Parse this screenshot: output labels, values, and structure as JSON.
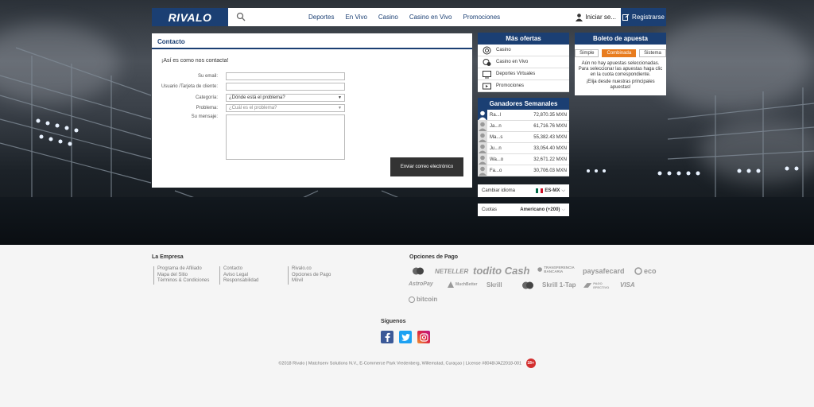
{
  "brand": {
    "logo_text": "RIVALO",
    "primary_color": "#1b3f73",
    "accent_color": "#e87c1e"
  },
  "header": {
    "nav": [
      "Deportes",
      "En Vivo",
      "Casino",
      "Casino en Vivo",
      "Promociones"
    ],
    "login_label": "Iniciar se...",
    "register_label": "Registrarse"
  },
  "contact": {
    "title": "Contacto",
    "intro": "¡Así es como nos contacta!",
    "fields": {
      "email_label": "Su email:",
      "user_label": "Usuario /Tarjeta de cliente:",
      "category_label": "Categoría:",
      "category_value": "¿Dónde está el problema?",
      "problem_label": "Problema:",
      "problem_value": "¿Cuál es el problema?",
      "message_label": "Su mensaje:"
    },
    "send_label": "Enviar correo electrónico"
  },
  "offers": {
    "title": "Más ofertas",
    "items": [
      {
        "label": "Casino",
        "icon": "casino-chip-icon"
      },
      {
        "label": "Casino en Vivo",
        "icon": "live-casino-icon"
      },
      {
        "label": "Deportes Virtuales",
        "icon": "virtual-sports-icon"
      },
      {
        "label": "Promociones",
        "icon": "promotions-icon"
      }
    ]
  },
  "winners": {
    "title": "Ganadores Semanales",
    "rows": [
      {
        "name": "Ra...l",
        "amount": "72,870.35 MXN"
      },
      {
        "name": "Ja...n",
        "amount": "61,716.76 MXN"
      },
      {
        "name": "Ma...s",
        "amount": "55,382.43 MXN"
      },
      {
        "name": "Ju...n",
        "amount": "33,054.40 MXN"
      },
      {
        "name": "Wa...o",
        "amount": "32,671.22 MXN"
      },
      {
        "name": "Fa...o",
        "amount": "30,706.03 MXN"
      }
    ]
  },
  "language": {
    "label": "Cambiar idioma",
    "value": "ES-MX"
  },
  "odds": {
    "label": "Cuotas",
    "value": "Americano (+200)"
  },
  "betslip": {
    "title": "Boleto de apuesta",
    "tabs": [
      "Simple",
      "Combinada",
      "Sistema"
    ],
    "message": "Aún no hay apuestas seleccionadas. Para seleccionar las apuestas haga clic en la cuota correspondiente.",
    "cta": "¡Elija desde nuestras principales apuestas!"
  },
  "footer": {
    "company_title": "La Empresa",
    "col1": [
      "Programa de Afiliado",
      "Mapa del Sitio",
      "Términos & Condiciones"
    ],
    "col2": [
      "Contacto",
      "Aviso Legal",
      "Responsabilidad"
    ],
    "col3": [
      "Rivalo.co",
      "Opciones de Pago",
      "Móvil"
    ],
    "payment_title": "Opciones de Pago",
    "payments": [
      "mastercard",
      "NETELLER",
      "todito Cash",
      "TRANSFERENCIA BANCARIA",
      "paysafecard",
      "eco",
      "AstroPay",
      "MuchBetter",
      "Skrill",
      "mastercard",
      "Skrill 1-Tap",
      "PAGO EFECTIVO",
      "VISA",
      "bitcoin"
    ],
    "social_title": "Síguenos",
    "copyright": "©2018 Rivalo | Matchserv Solutions N.V., E-Commerce Park Vredenberg, Willemstad, Curaçao | License #8048/JAZ2018-001",
    "age": "18+"
  }
}
